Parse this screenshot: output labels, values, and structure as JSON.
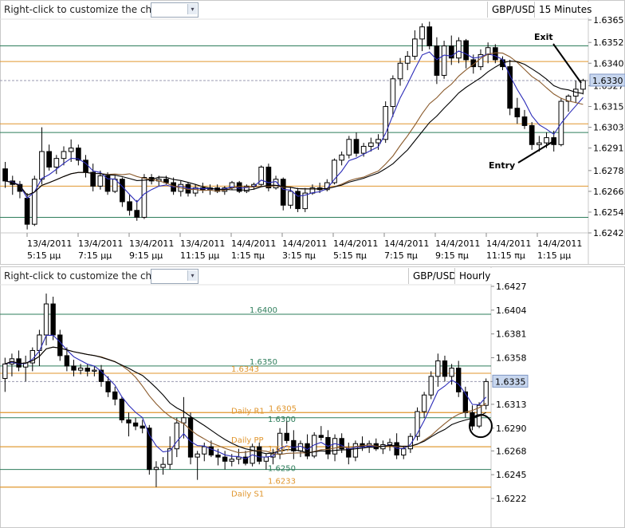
{
  "colors": {
    "grid_green": "#2e7d5b",
    "level_orange": "#e0962e",
    "candle": "#000000",
    "ma_fast": "#2b2bb8",
    "ma_slow": "#000000",
    "ma_mid": "#8a5a2b",
    "price_tag": "#c8d7ef"
  },
  "top_panel": {
    "hint": "Right-click to customize the chart",
    "symbol": "GBP/USD",
    "timeframe": "15 Minutes",
    "annotations": {
      "exit": "Exit",
      "entry": "Entry"
    },
    "price_label": "1.6330",
    "chart_data": {
      "type": "candlestick",
      "yticks": [
        "1.6365",
        "1.6352",
        "1.6340",
        "1.6327",
        "1.6315",
        "1.6303",
        "1.6291",
        "1.6278",
        "1.6266",
        "1.6254",
        "1.6242"
      ],
      "ylim": [
        1.6242,
        1.6365
      ],
      "x_labels": [
        {
          "date": "13/4/2011",
          "time": "5:15 μμ"
        },
        {
          "date": "13/4/2011",
          "time": "7:15 μμ"
        },
        {
          "date": "13/4/2011",
          "time": "9:15 μμ"
        },
        {
          "date": "13/4/2011",
          "time": "11:15 μμ"
        },
        {
          "date": "14/4/2011",
          "time": "1:15 πμ"
        },
        {
          "date": "14/4/2011",
          "time": "3:15 πμ"
        },
        {
          "date": "14/4/2011",
          "time": "5:15 πμ"
        },
        {
          "date": "14/4/2011",
          "time": "7:15 πμ"
        },
        {
          "date": "14/4/2011",
          "time": "9:15 πμ"
        },
        {
          "date": "14/4/2011",
          "time": "11:15 πμ"
        },
        {
          "date": "14/4/2011",
          "time": "1:15 μμ"
        }
      ],
      "levels": [
        {
          "price": 1.635,
          "color": "green"
        },
        {
          "price": 1.6341,
          "color": "orange"
        },
        {
          "price": 1.6305,
          "color": "orange"
        },
        {
          "price": 1.63,
          "color": "green"
        },
        {
          "price": 1.6269,
          "color": "orange"
        },
        {
          "price": 1.6251,
          "color": "green"
        }
      ],
      "current_price": 1.633,
      "candles": [
        [
          1.6279,
          1.6283,
          1.6268,
          1.6272
        ],
        [
          1.6272,
          1.6275,
          1.6264,
          1.627
        ],
        [
          1.627,
          1.6272,
          1.6262,
          1.6266
        ],
        [
          1.6262,
          1.6265,
          1.6244,
          1.6247
        ],
        [
          1.6247,
          1.6275,
          1.6246,
          1.6273
        ],
        [
          1.6273,
          1.6303,
          1.627,
          1.6289
        ],
        [
          1.6289,
          1.6293,
          1.6278,
          1.628
        ],
        [
          1.628,
          1.6287,
          1.6276,
          1.6285
        ],
        [
          1.6285,
          1.6292,
          1.6281,
          1.6289
        ],
        [
          1.6289,
          1.6296,
          1.6283,
          1.6291
        ],
        [
          1.6291,
          1.6293,
          1.6281,
          1.6284
        ],
        [
          1.6284,
          1.6287,
          1.6274,
          1.6277
        ],
        [
          1.6277,
          1.6282,
          1.6266,
          1.6269
        ],
        [
          1.6269,
          1.6278,
          1.6267,
          1.6275
        ],
        [
          1.6275,
          1.6277,
          1.6264,
          1.6266
        ],
        [
          1.6266,
          1.6275,
          1.6265,
          1.6273
        ],
        [
          1.6273,
          1.6274,
          1.6257,
          1.626
        ],
        [
          1.626,
          1.6264,
          1.6252,
          1.6255
        ],
        [
          1.6255,
          1.6261,
          1.6249,
          1.6251
        ],
        [
          1.6251,
          1.6276,
          1.625,
          1.6274
        ],
        [
          1.6274,
          1.6276,
          1.627,
          1.6272
        ],
        [
          1.6272,
          1.6275,
          1.6269,
          1.6273
        ],
        [
          1.6273,
          1.6275,
          1.627,
          1.6271
        ],
        [
          1.6271,
          1.6274,
          1.6264,
          1.6266
        ],
        [
          1.6266,
          1.6272,
          1.6263,
          1.627
        ],
        [
          1.627,
          1.6271,
          1.6263,
          1.6265
        ],
        [
          1.6265,
          1.627,
          1.6263,
          1.6268
        ],
        [
          1.6268,
          1.6271,
          1.6265,
          1.6267
        ],
        [
          1.6267,
          1.627,
          1.6264,
          1.6268
        ],
        [
          1.6268,
          1.627,
          1.6265,
          1.6266
        ],
        [
          1.6266,
          1.6269,
          1.6264,
          1.6268
        ],
        [
          1.6268,
          1.6272,
          1.6267,
          1.6271
        ],
        [
          1.6271,
          1.6272,
          1.6265,
          1.6266
        ],
        [
          1.6266,
          1.627,
          1.6265,
          1.6269
        ],
        [
          1.6269,
          1.6271,
          1.6267,
          1.627
        ],
        [
          1.627,
          1.6281,
          1.6269,
          1.628
        ],
        [
          1.628,
          1.6282,
          1.6266,
          1.6268
        ],
        [
          1.6268,
          1.6275,
          1.6267,
          1.6273
        ],
        [
          1.6273,
          1.6274,
          1.6255,
          1.6258
        ],
        [
          1.6258,
          1.6268,
          1.6256,
          1.6266
        ],
        [
          1.6266,
          1.6268,
          1.6254,
          1.6256
        ],
        [
          1.6256,
          1.6268,
          1.6254,
          1.6265
        ],
        [
          1.6265,
          1.627,
          1.6264,
          1.6268
        ],
        [
          1.6268,
          1.6271,
          1.6265,
          1.6267
        ],
        [
          1.6267,
          1.6273,
          1.6266,
          1.6271
        ],
        [
          1.6271,
          1.6285,
          1.627,
          1.6284
        ],
        [
          1.6284,
          1.6289,
          1.6281,
          1.6287
        ],
        [
          1.6287,
          1.6298,
          1.6285,
          1.6296
        ],
        [
          1.6296,
          1.63,
          1.6286,
          1.6288
        ],
        [
          1.6288,
          1.6294,
          1.6286,
          1.6292
        ],
        [
          1.6292,
          1.6297,
          1.6289,
          1.6294
        ],
        [
          1.6294,
          1.6299,
          1.629,
          1.6296
        ],
        [
          1.6296,
          1.6318,
          1.6294,
          1.6315
        ],
        [
          1.6315,
          1.6333,
          1.6309,
          1.6331
        ],
        [
          1.6331,
          1.6343,
          1.6327,
          1.634
        ],
        [
          1.634,
          1.6347,
          1.6336,
          1.6344
        ],
        [
          1.6344,
          1.6359,
          1.6342,
          1.6354
        ],
        [
          1.6354,
          1.6363,
          1.6347,
          1.6361
        ],
        [
          1.6361,
          1.6364,
          1.6348,
          1.635
        ],
        [
          1.635,
          1.6355,
          1.6328,
          1.6333
        ],
        [
          1.6333,
          1.6353,
          1.6331,
          1.635
        ],
        [
          1.635,
          1.6356,
          1.6339,
          1.6343
        ],
        [
          1.6343,
          1.6355,
          1.634,
          1.6353
        ],
        [
          1.6353,
          1.6354,
          1.6337,
          1.6342
        ],
        [
          1.6342,
          1.6345,
          1.6334,
          1.6338
        ],
        [
          1.6338,
          1.6348,
          1.6336,
          1.6345
        ],
        [
          1.6345,
          1.6352,
          1.634,
          1.6349
        ],
        [
          1.6349,
          1.6351,
          1.634,
          1.6342
        ],
        [
          1.6342,
          1.6344,
          1.6336,
          1.6338
        ],
        [
          1.6338,
          1.6342,
          1.631,
          1.6314
        ],
        [
          1.6314,
          1.632,
          1.6305,
          1.6309
        ],
        [
          1.6309,
          1.6313,
          1.6302,
          1.6304
        ],
        [
          1.6304,
          1.6306,
          1.629,
          1.6293
        ],
        [
          1.6293,
          1.6298,
          1.6289,
          1.6294
        ],
        [
          1.6294,
          1.63,
          1.6291,
          1.6297
        ],
        [
          1.6297,
          1.6301,
          1.6289,
          1.6293
        ],
        [
          1.6293,
          1.632,
          1.6292,
          1.6318
        ],
        [
          1.6318,
          1.6322,
          1.6312,
          1.6321
        ],
        [
          1.6321,
          1.633,
          1.6317,
          1.6325
        ],
        [
          1.6325,
          1.6331,
          1.6322,
          1.633
        ]
      ]
    }
  },
  "bottom_panel": {
    "hint": "Right-click to customize the chart",
    "symbol": "GBP/USD",
    "timeframe": "Hourly",
    "price_label": "1.6335",
    "chart_data": {
      "type": "candlestick",
      "yticks": [
        "1.6427",
        "1.6404",
        "1.6381",
        "1.6358",
        "1.6335",
        "1.6313",
        "1.6290",
        "1.6268",
        "1.6245",
        "1.6222"
      ],
      "ylim": [
        1.6222,
        1.6427
      ],
      "levels": [
        {
          "price": 1.64,
          "color": "green",
          "label": "1.6400"
        },
        {
          "price": 1.635,
          "color": "green",
          "label": "1.6350"
        },
        {
          "price": 1.6343,
          "color": "orange",
          "label": "1.6343"
        },
        {
          "price": 1.6305,
          "color": "orange",
          "label": "Daily R1"
        },
        {
          "price": 1.6305,
          "color": "orange",
          "label": "1.6305"
        },
        {
          "price": 1.63,
          "color": "green",
          "label": "1.6300"
        },
        {
          "price": 1.6272,
          "color": "orange",
          "label": "Daily PP"
        },
        {
          "price": 1.6272,
          "color": "orange",
          "label": "1.627"
        },
        {
          "price": 1.625,
          "color": "green",
          "label": "1.6250"
        },
        {
          "price": 1.6233,
          "color": "orange",
          "label": "1.6233"
        },
        {
          "price": 1.6233,
          "color": "orange",
          "label": "Daily S1"
        }
      ],
      "current_price": 1.6335,
      "candles": [
        [
          1.6338,
          1.6358,
          1.6325,
          1.6352
        ],
        [
          1.6352,
          1.6362,
          1.634,
          1.6357
        ],
        [
          1.6357,
          1.6365,
          1.6345,
          1.6349
        ],
        [
          1.6349,
          1.636,
          1.6335,
          1.6353
        ],
        [
          1.6353,
          1.6368,
          1.6345,
          1.6365
        ],
        [
          1.6365,
          1.6385,
          1.635,
          1.638
        ],
        [
          1.638,
          1.642,
          1.637,
          1.641
        ],
        [
          1.641,
          1.6417,
          1.6375,
          1.638
        ],
        [
          1.638,
          1.6385,
          1.6355,
          1.636
        ],
        [
          1.636,
          1.6368,
          1.6345,
          1.635
        ],
        [
          1.635,
          1.6356,
          1.634,
          1.6346
        ],
        [
          1.6346,
          1.6352,
          1.6342,
          1.6348
        ],
        [
          1.6348,
          1.6352,
          1.634,
          1.6345
        ],
        [
          1.6345,
          1.635,
          1.634,
          1.6346
        ],
        [
          1.6346,
          1.6351,
          1.633,
          1.6335
        ],
        [
          1.6335,
          1.634,
          1.632,
          1.6325
        ],
        [
          1.6325,
          1.633,
          1.6312,
          1.6318
        ],
        [
          1.6318,
          1.632,
          1.6295,
          1.6298
        ],
        [
          1.6298,
          1.6305,
          1.6282,
          1.6295
        ],
        [
          1.6295,
          1.63,
          1.6288,
          1.6292
        ],
        [
          1.6292,
          1.6298,
          1.6285,
          1.629
        ],
        [
          1.629,
          1.6293,
          1.6245,
          1.625
        ],
        [
          1.625,
          1.6258,
          1.6233,
          1.6252
        ],
        [
          1.6252,
          1.6262,
          1.6245,
          1.6255
        ],
        [
          1.6255,
          1.6282,
          1.625,
          1.627
        ],
        [
          1.627,
          1.63,
          1.6262,
          1.6295
        ],
        [
          1.6295,
          1.632,
          1.628,
          1.63
        ],
        [
          1.63,
          1.6305,
          1.6255,
          1.6262
        ],
        [
          1.6262,
          1.6268,
          1.624,
          1.6265
        ],
        [
          1.6265,
          1.6276,
          1.6258,
          1.6272
        ],
        [
          1.6272,
          1.6278,
          1.6262,
          1.6264
        ],
        [
          1.6264,
          1.627,
          1.6254,
          1.6262
        ],
        [
          1.6262,
          1.6268,
          1.625,
          1.6258
        ],
        [
          1.6258,
          1.6265,
          1.6253,
          1.626
        ],
        [
          1.626,
          1.627,
          1.6255,
          1.6262
        ],
        [
          1.6262,
          1.6268,
          1.6254,
          1.6256
        ],
        [
          1.6256,
          1.6275,
          1.6253,
          1.6272
        ],
        [
          1.6272,
          1.6276,
          1.6255,
          1.6258
        ],
        [
          1.6258,
          1.6265,
          1.625,
          1.6262
        ],
        [
          1.6262,
          1.627,
          1.6255,
          1.6265
        ],
        [
          1.6265,
          1.629,
          1.626,
          1.6285
        ],
        [
          1.6285,
          1.6297,
          1.6275,
          1.6278
        ],
        [
          1.6278,
          1.6288,
          1.626,
          1.6268
        ],
        [
          1.6268,
          1.6278,
          1.6262,
          1.6275
        ],
        [
          1.6275,
          1.6284,
          1.626,
          1.6263
        ],
        [
          1.6263,
          1.6286,
          1.6261,
          1.6283
        ],
        [
          1.6283,
          1.6292,
          1.6278,
          1.6281
        ],
        [
          1.6281,
          1.6288,
          1.626,
          1.6265
        ],
        [
          1.6265,
          1.6284,
          1.6258,
          1.628
        ],
        [
          1.628,
          1.6285,
          1.6266,
          1.627
        ],
        [
          1.627,
          1.6276,
          1.6255,
          1.6262
        ],
        [
          1.6262,
          1.6278,
          1.6258,
          1.6275
        ],
        [
          1.6275,
          1.6282,
          1.6268,
          1.6272
        ],
        [
          1.6272,
          1.6278,
          1.6266,
          1.6275
        ],
        [
          1.6275,
          1.628,
          1.6268,
          1.627
        ],
        [
          1.627,
          1.6278,
          1.6265,
          1.6274
        ],
        [
          1.6274,
          1.628,
          1.6268,
          1.6276
        ],
        [
          1.6276,
          1.6285,
          1.626,
          1.6264
        ],
        [
          1.6264,
          1.6272,
          1.626,
          1.627
        ],
        [
          1.627,
          1.6285,
          1.6266,
          1.6282
        ],
        [
          1.6282,
          1.631,
          1.6278,
          1.6306
        ],
        [
          1.6306,
          1.6325,
          1.63,
          1.6322
        ],
        [
          1.6322,
          1.6345,
          1.6318,
          1.634
        ],
        [
          1.634,
          1.6362,
          1.633,
          1.6355
        ],
        [
          1.6355,
          1.636,
          1.6335,
          1.634
        ],
        [
          1.634,
          1.6352,
          1.6332,
          1.6348
        ],
        [
          1.6348,
          1.6355,
          1.632,
          1.6325
        ],
        [
          1.6325,
          1.633,
          1.63,
          1.6305
        ],
        [
          1.6305,
          1.6312,
          1.6288,
          1.6292
        ],
        [
          1.6292,
          1.6315,
          1.629,
          1.6312
        ],
        [
          1.6312,
          1.6338,
          1.6308,
          1.6335
        ]
      ]
    }
  }
}
